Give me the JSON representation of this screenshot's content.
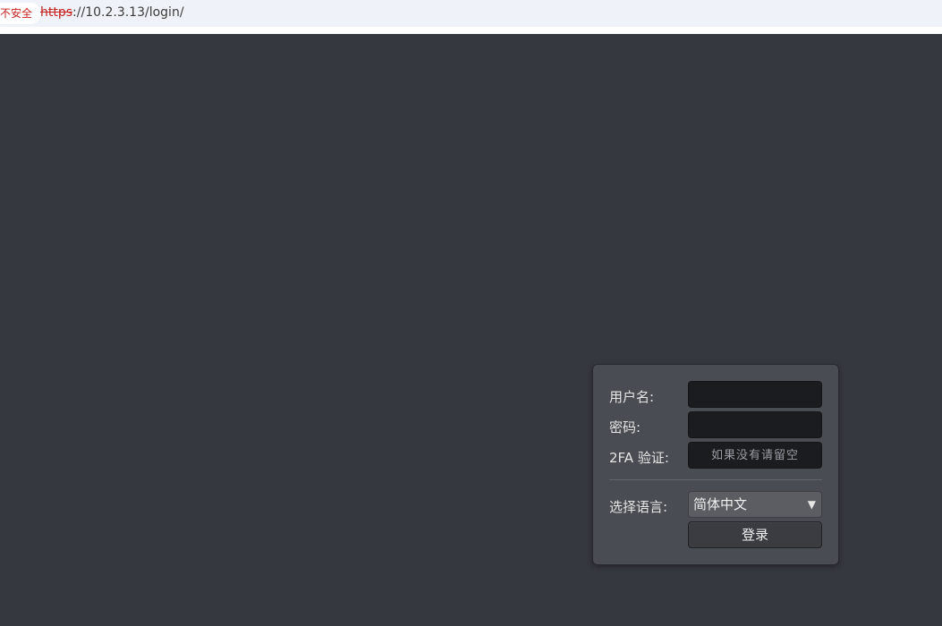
{
  "browser": {
    "security_label": "不安全",
    "url_scheme": "https",
    "url_rest": "://10.2.3.13/login/"
  },
  "login": {
    "username_label": "用户名:",
    "username_value": "",
    "password_label": "密码:",
    "password_value": "",
    "twofa_label": "2FA 验证:",
    "twofa_placeholder": "如果没有请留空",
    "language_label": "选择语言:",
    "language_selected": "简体中文",
    "submit_label": "登录"
  },
  "colors": {
    "page_background": "#363840",
    "panel_background": "#4a4c53",
    "field_background": "#1b1c20",
    "insecure_red": "#c5221f"
  },
  "icons": {
    "language_dropdown": "triangle-down-icon"
  }
}
